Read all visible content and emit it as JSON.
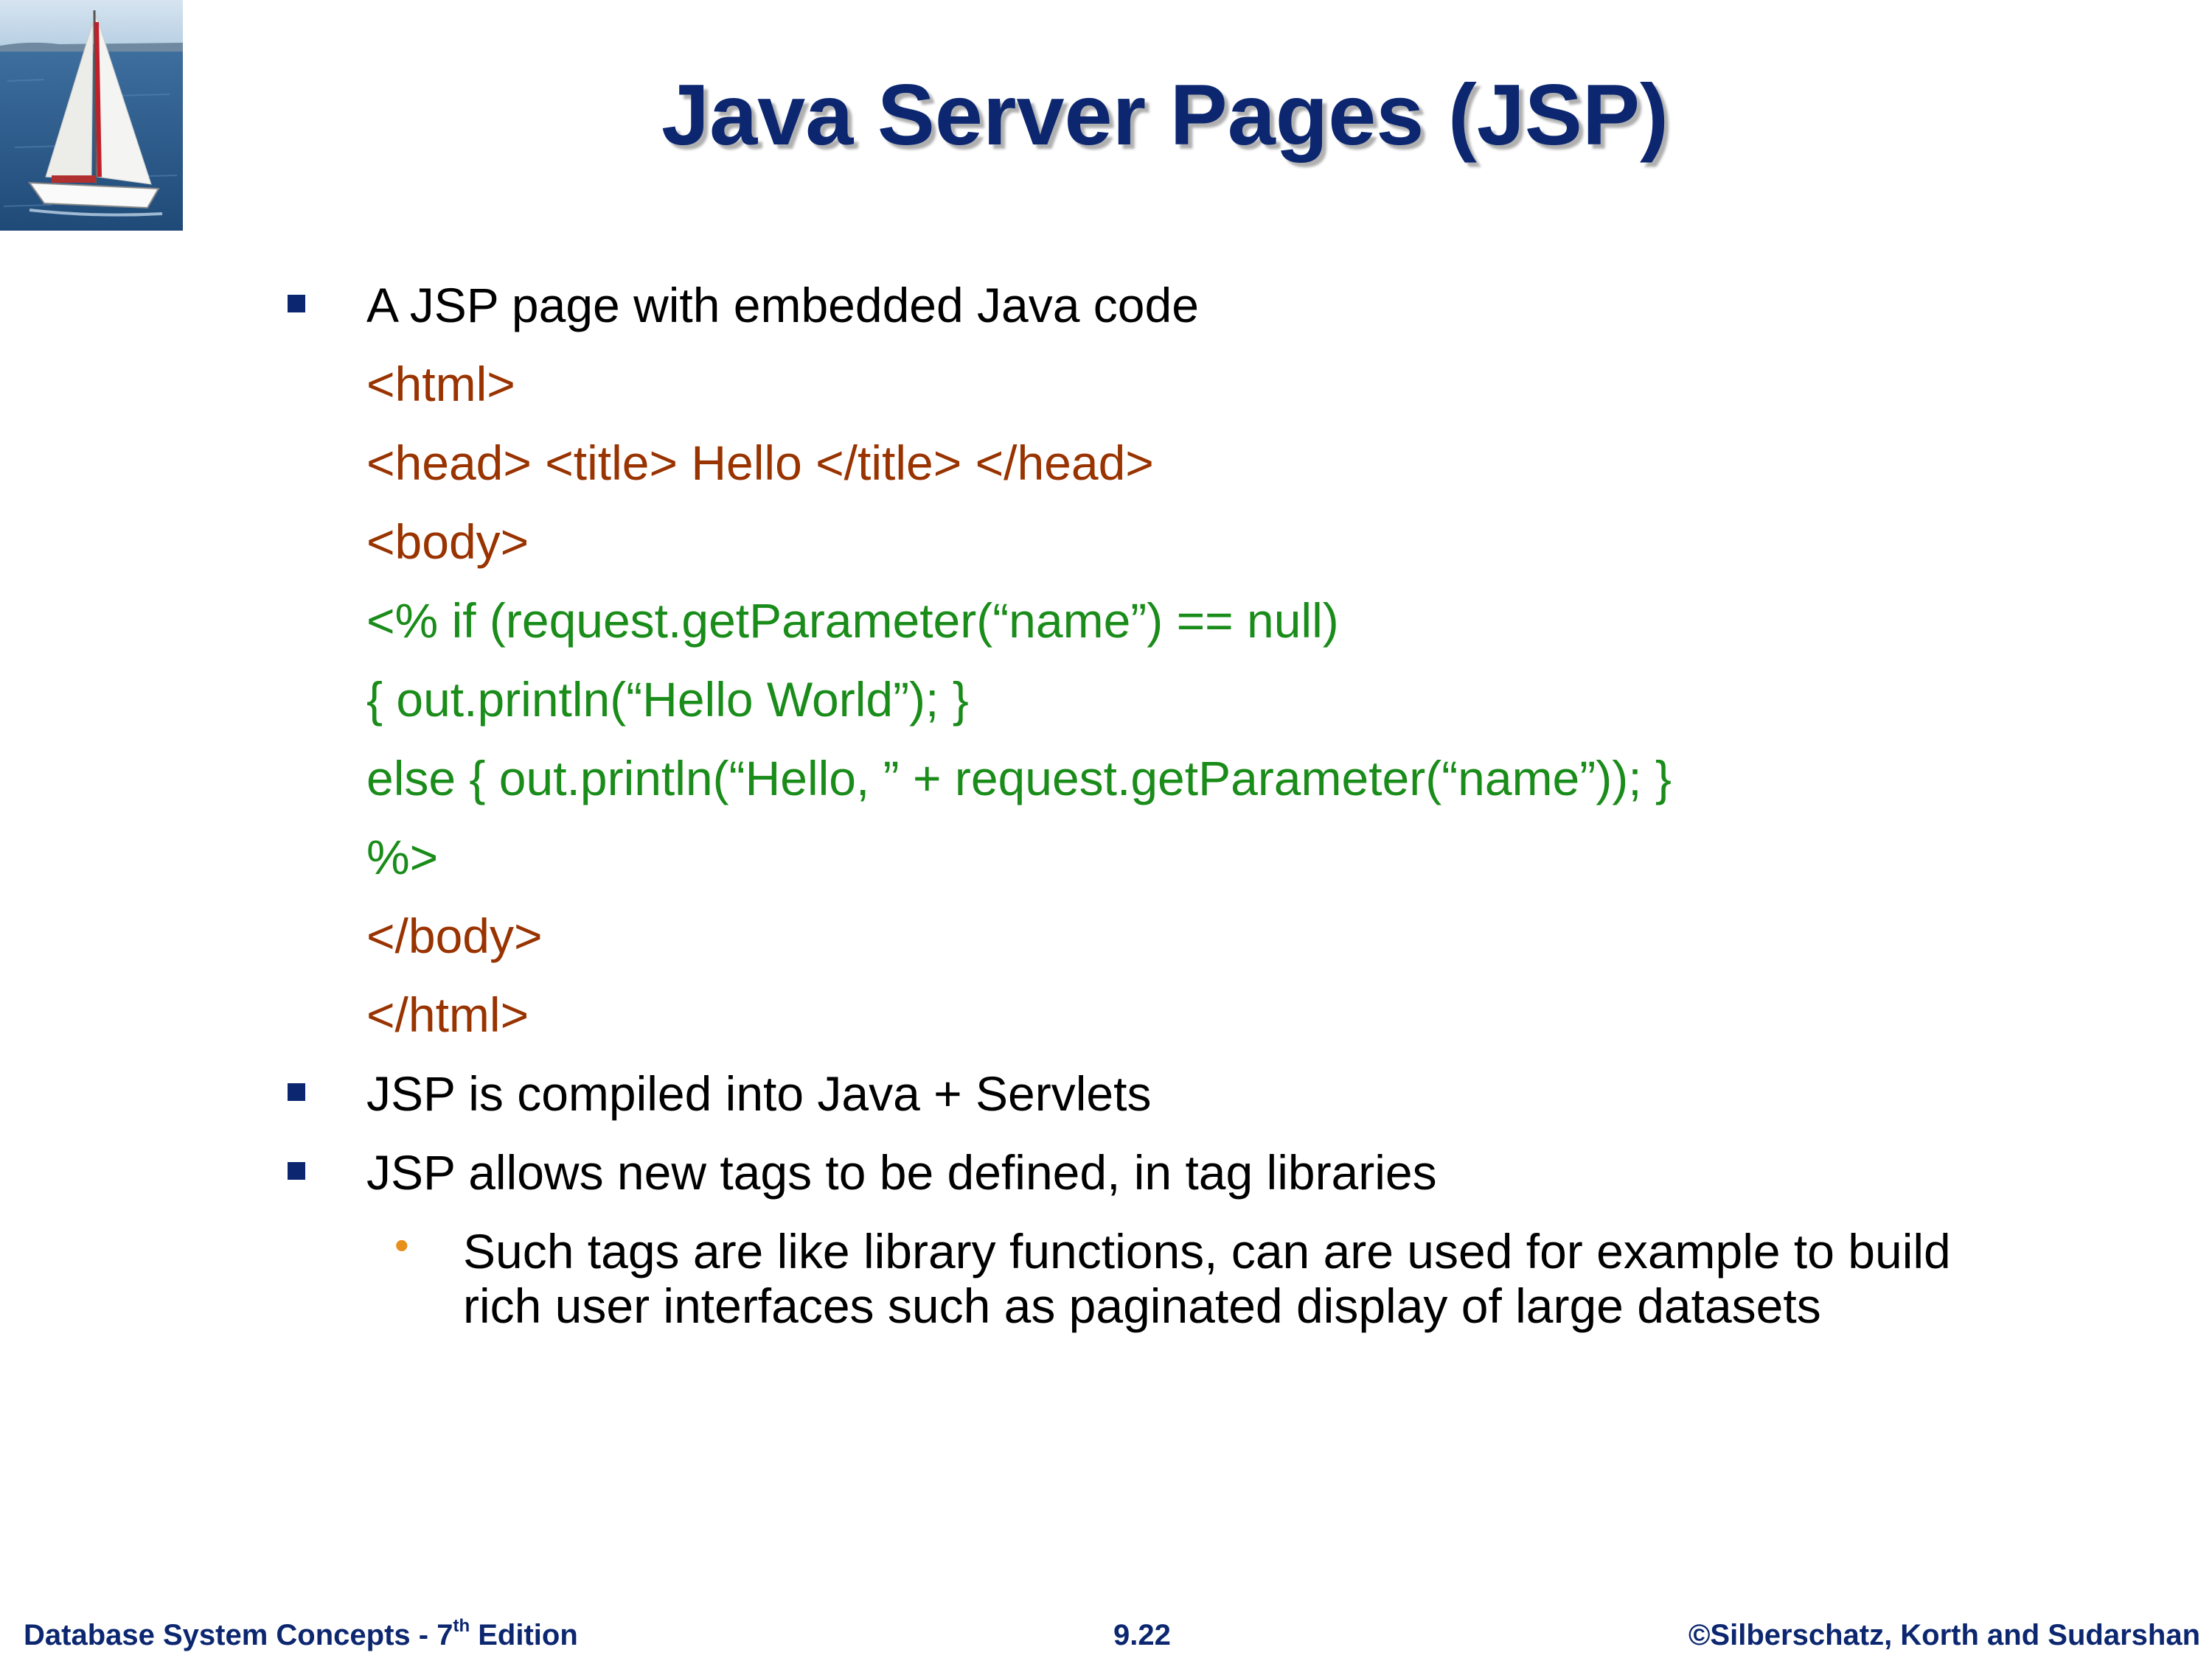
{
  "slide": {
    "title": "Java Server Pages (JSP)",
    "bullets": [
      {
        "text": "A JSP page with embedded Java code"
      },
      {
        "text": "JSP is compiled into Java + Servlets"
      },
      {
        "text": "JSP allows new tags to be defined, in tag libraries"
      }
    ],
    "code": {
      "line1": "<html>",
      "line2": "<head> <title> Hello </title> </head>",
      "line3": "<body>",
      "line4": "<% if (request.getParameter(“name”) == null)",
      "line5": "{ out.println(“Hello World”); }",
      "line6": "else { out.println(“Hello, ” + request.getParameter(“name”)); }",
      "line7": "%>",
      "line8": "</body>",
      "line9": "</html>"
    },
    "sub_bullet": {
      "line1": "Such tags are like library functions, can are used for example to build",
      "line2": "rich user interfaces such as paginated display of large datasets"
    }
  },
  "footer": {
    "left_prefix": "Database System Concepts - 7",
    "left_sup": "th",
    "left_suffix": " Edition",
    "center": "9.22",
    "right": "©Silberschatz, Korth and Sudarshan"
  },
  "colors": {
    "title": "#0c2770",
    "html_code": "#993300",
    "java_code": "#1a8c1a",
    "sub_bullet": "#e8901c"
  }
}
